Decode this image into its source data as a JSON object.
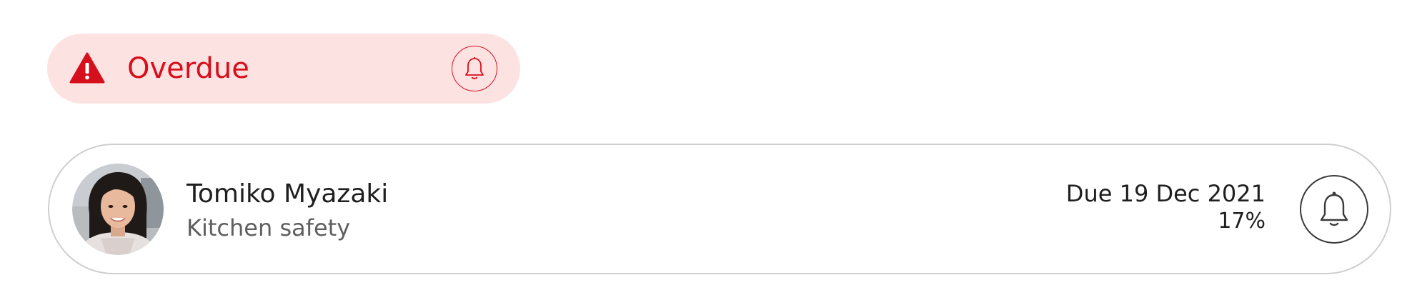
{
  "status_banner": {
    "label": "Overdue",
    "icon": "warning-triangle-icon",
    "reminder_icon": "bell-icon",
    "accent_color": "#d60f1d",
    "background_color": "#fde2e2"
  },
  "assignment": {
    "person_name": "Tomiko Myazaki",
    "course": "Kitchen safety",
    "due_text": "Due 19 Dec 2021",
    "progress_text": "17%",
    "progress_value": 17,
    "action_icon": "bell-icon"
  }
}
